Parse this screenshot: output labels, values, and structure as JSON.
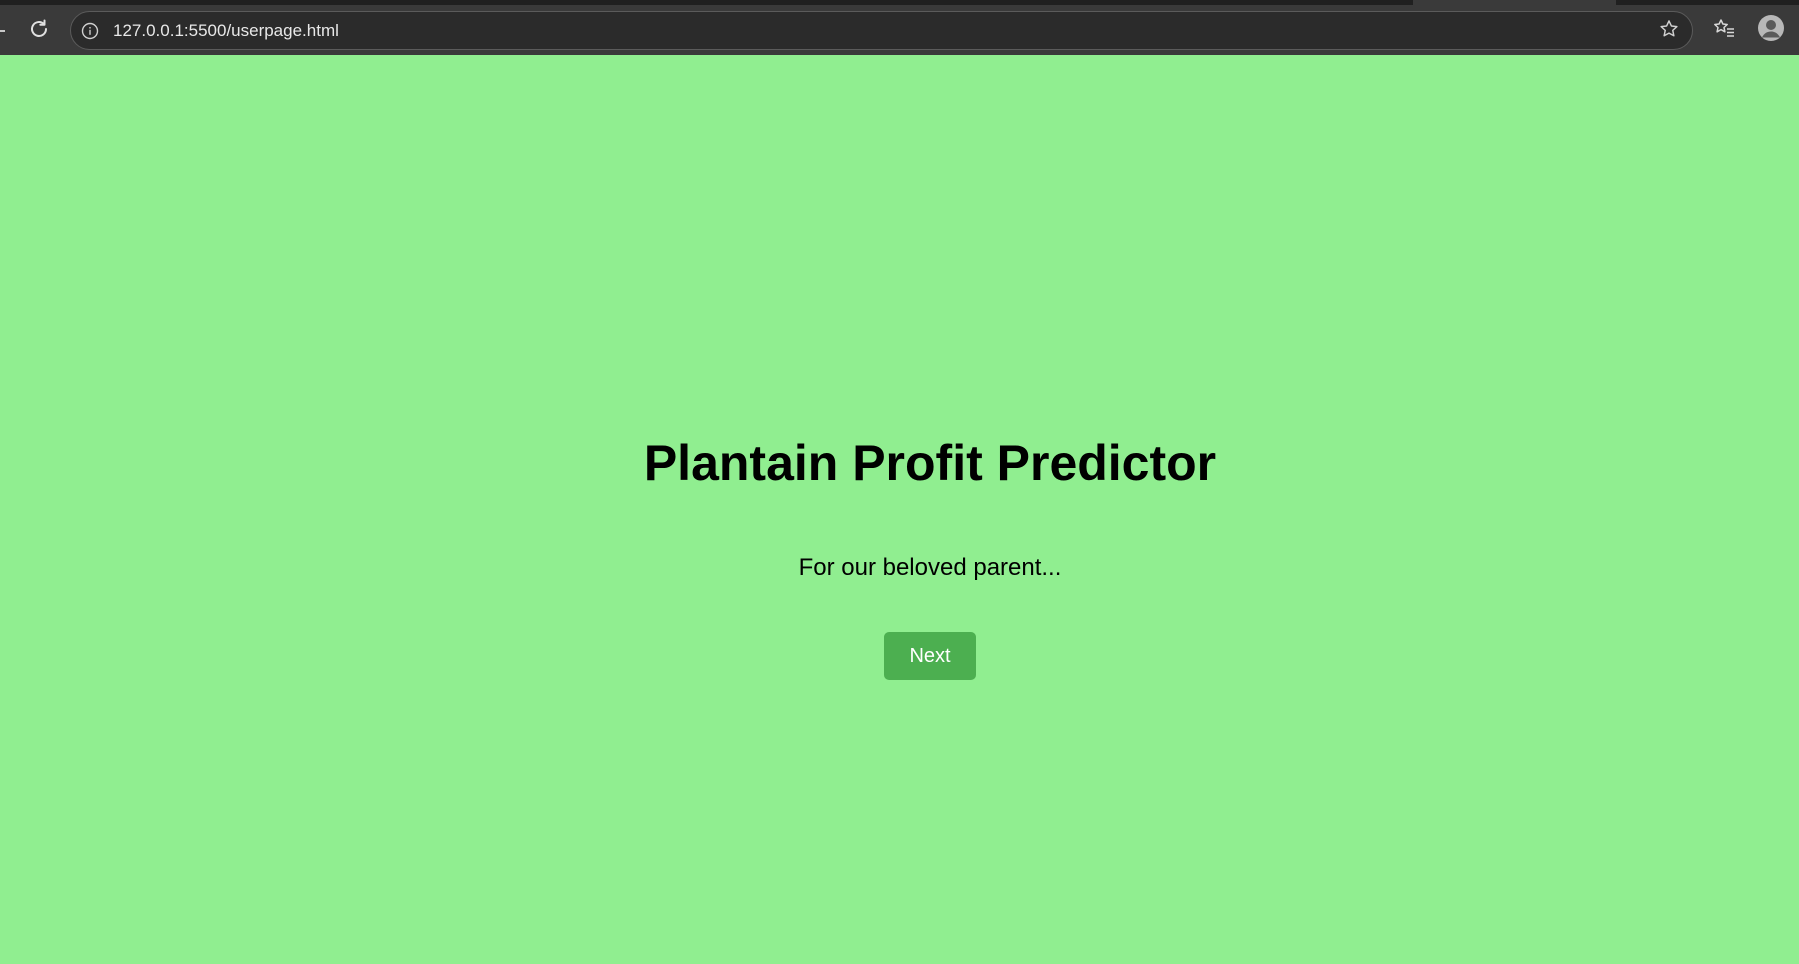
{
  "browser": {
    "url": "127.0.0.1:5500/userpage.html",
    "icons": {
      "reload": "reload-icon",
      "site_info": "info-icon",
      "bookmark": "star-icon",
      "favorites": "favorites-icon",
      "profile": "profile-icon"
    }
  },
  "page": {
    "background_color": "#90ee90",
    "title": "Plantain Profit Predictor",
    "subtitle": "For our beloved parent...",
    "next_button_label": "Next",
    "next_button_color": "#4caf50"
  }
}
